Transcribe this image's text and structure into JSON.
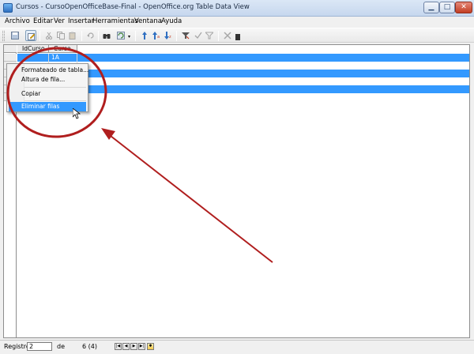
{
  "window": {
    "title": "Cursos - CursoOpenOfficeBase-Final - OpenOffice.org Table Data View",
    "min_glyph": "▁",
    "max_glyph": "□",
    "close_glyph": "✕"
  },
  "menu": {
    "items": [
      "Archivo",
      "Editar",
      "Ver",
      "Insertar",
      "Herramientas",
      "Ventana",
      "Ayuda"
    ]
  },
  "toolbar": {
    "icons": [
      "save-icon",
      "edit-mode-icon",
      "cut-icon",
      "copy-icon",
      "paste-icon",
      "undo-icon",
      "find-icon",
      "refresh-icon",
      "sort-icon",
      "sort-ascending-icon",
      "sort-descending-icon",
      "autofilter-icon",
      "standard-filter-icon",
      "remove-filter-icon",
      "delete-record-icon"
    ]
  },
  "grid": {
    "columns": [
      "IdCurso",
      "Curso"
    ],
    "rows": [
      {
        "id": "",
        "curso": "1A",
        "selected": true
      },
      {
        "id": "",
        "curso": "",
        "selected": false
      },
      {
        "id": "",
        "curso": "",
        "selected": true
      },
      {
        "id": "",
        "curso": "",
        "selected": false
      },
      {
        "id": "",
        "curso": "",
        "selected": true
      },
      {
        "id": "",
        "curso": "",
        "selected": false
      }
    ]
  },
  "context_menu": {
    "items": [
      "Formateado de tabla...",
      "Altura de fila...",
      "Copiar",
      "Eliminar filas"
    ],
    "highlighted": "Eliminar filas"
  },
  "annotation": {
    "color": "#b01e1e"
  },
  "statusbar": {
    "registro_label": "Registro",
    "registro_value": "2",
    "de_label": "de",
    "total": "6 (4)",
    "nav": [
      "|◀",
      "◀",
      "▶",
      "▶|",
      "✱"
    ]
  },
  "colors": {
    "selection": "#3399ff",
    "annotation": "#b01e1e"
  }
}
